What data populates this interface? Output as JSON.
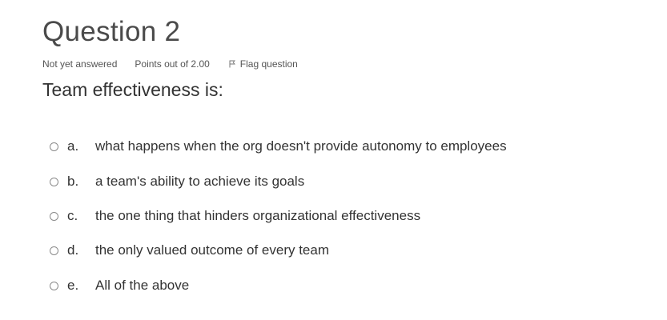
{
  "question": {
    "title": "Question 2",
    "status": "Not yet answered",
    "grade": "Points out of 2.00",
    "flag_label": "Flag question",
    "text": "Team effectiveness is:"
  },
  "answers": [
    {
      "letter": "a.",
      "text": "what happens when the org doesn't provide autonomy to employees"
    },
    {
      "letter": "b.",
      "text": "a team's ability to achieve its goals"
    },
    {
      "letter": "c.",
      "text": "the one thing that hinders organizational effectiveness"
    },
    {
      "letter": "d.",
      "text": "the only valued outcome of every team"
    },
    {
      "letter": "e.",
      "text": "All of the above"
    }
  ]
}
